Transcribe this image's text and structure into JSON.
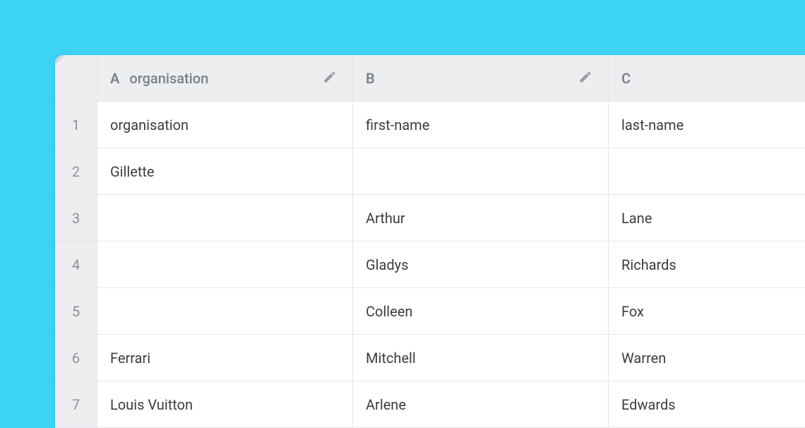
{
  "columns": [
    {
      "letter": "A",
      "name": "organisation"
    },
    {
      "letter": "B",
      "name": ""
    },
    {
      "letter": "C",
      "name": ""
    }
  ],
  "rows": [
    {
      "num": "1",
      "cells": [
        "organisation",
        "first-name",
        "last-name"
      ]
    },
    {
      "num": "2",
      "cells": [
        "Gillette",
        "",
        ""
      ]
    },
    {
      "num": "3",
      "cells": [
        "",
        "Arthur",
        "Lane"
      ]
    },
    {
      "num": "4",
      "cells": [
        "",
        "Gladys",
        "Richards"
      ]
    },
    {
      "num": "5",
      "cells": [
        "",
        "Colleen",
        "Fox"
      ]
    },
    {
      "num": "6",
      "cells": [
        "Ferrari",
        "Mitchell",
        "Warren"
      ]
    },
    {
      "num": "7",
      "cells": [
        "Louis Vuitton",
        "Arlene",
        "Edwards"
      ]
    }
  ]
}
